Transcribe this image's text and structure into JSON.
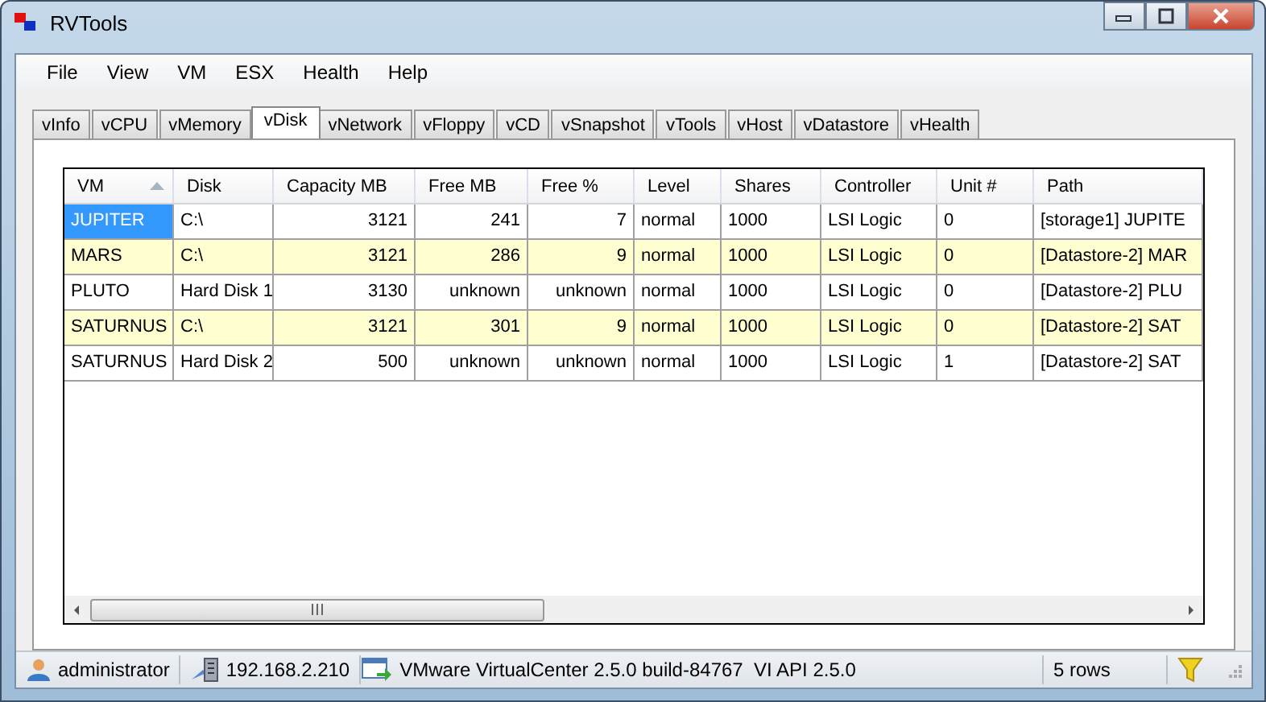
{
  "window": {
    "title": "RVTools"
  },
  "menu": [
    "File",
    "View",
    "VM",
    "ESX",
    "Health",
    "Help"
  ],
  "tabs": [
    {
      "label": "vInfo",
      "selected": false
    },
    {
      "label": "vCPU",
      "selected": false
    },
    {
      "label": "vMemory",
      "selected": false
    },
    {
      "label": "vDisk",
      "selected": true
    },
    {
      "label": "vNetwork",
      "selected": false
    },
    {
      "label": "vFloppy",
      "selected": false
    },
    {
      "label": "vCD",
      "selected": false
    },
    {
      "label": "vSnapshot",
      "selected": false
    },
    {
      "label": "vTools",
      "selected": false
    },
    {
      "label": "vHost",
      "selected": false
    },
    {
      "label": "vDatastore",
      "selected": false
    },
    {
      "label": "vHealth",
      "selected": false
    }
  ],
  "table": {
    "columns": [
      {
        "label": "VM",
        "sorted": true
      },
      {
        "label": "Disk",
        "sorted": false
      },
      {
        "label": "Capacity MB",
        "sorted": false
      },
      {
        "label": "Free MB",
        "sorted": false
      },
      {
        "label": "Free %",
        "sorted": false
      },
      {
        "label": "Level",
        "sorted": false
      },
      {
        "label": "Shares",
        "sorted": false
      },
      {
        "label": "Controller",
        "sorted": false
      },
      {
        "label": "Unit #",
        "sorted": false
      },
      {
        "label": "Path",
        "sorted": false
      }
    ],
    "rows": [
      {
        "selected": true,
        "cells": [
          "JUPITER",
          "C:\\",
          "3121",
          "241",
          "7",
          "normal",
          "1000",
          "LSI Logic",
          "0",
          "[storage1] JUPITE"
        ]
      },
      {
        "selected": false,
        "cells": [
          "MARS",
          "C:\\",
          "3121",
          "286",
          "9",
          "normal",
          "1000",
          "LSI Logic",
          "0",
          "[Datastore-2] MAR"
        ]
      },
      {
        "selected": false,
        "cells": [
          "PLUTO",
          "Hard Disk 1",
          "3130",
          "unknown",
          "unknown",
          "normal",
          "1000",
          "LSI Logic",
          "0",
          "[Datastore-2] PLU"
        ]
      },
      {
        "selected": false,
        "cells": [
          "SATURNUS",
          "C:\\",
          "3121",
          "301",
          "9",
          "normal",
          "1000",
          "LSI Logic",
          "0",
          "[Datastore-2] SAT"
        ]
      },
      {
        "selected": false,
        "cells": [
          "SATURNUS",
          "Hard Disk 2",
          "500",
          "unknown",
          "unknown",
          "normal",
          "1000",
          "LSI Logic",
          "1",
          "[Datastore-2] SAT"
        ]
      }
    ]
  },
  "status_bar": {
    "user": "administrator",
    "host": "192.168.2.210",
    "server": "VMware VirtualCenter 2.5.0 build-84767  VI API 2.5.0",
    "row_count": "5 rows"
  }
}
